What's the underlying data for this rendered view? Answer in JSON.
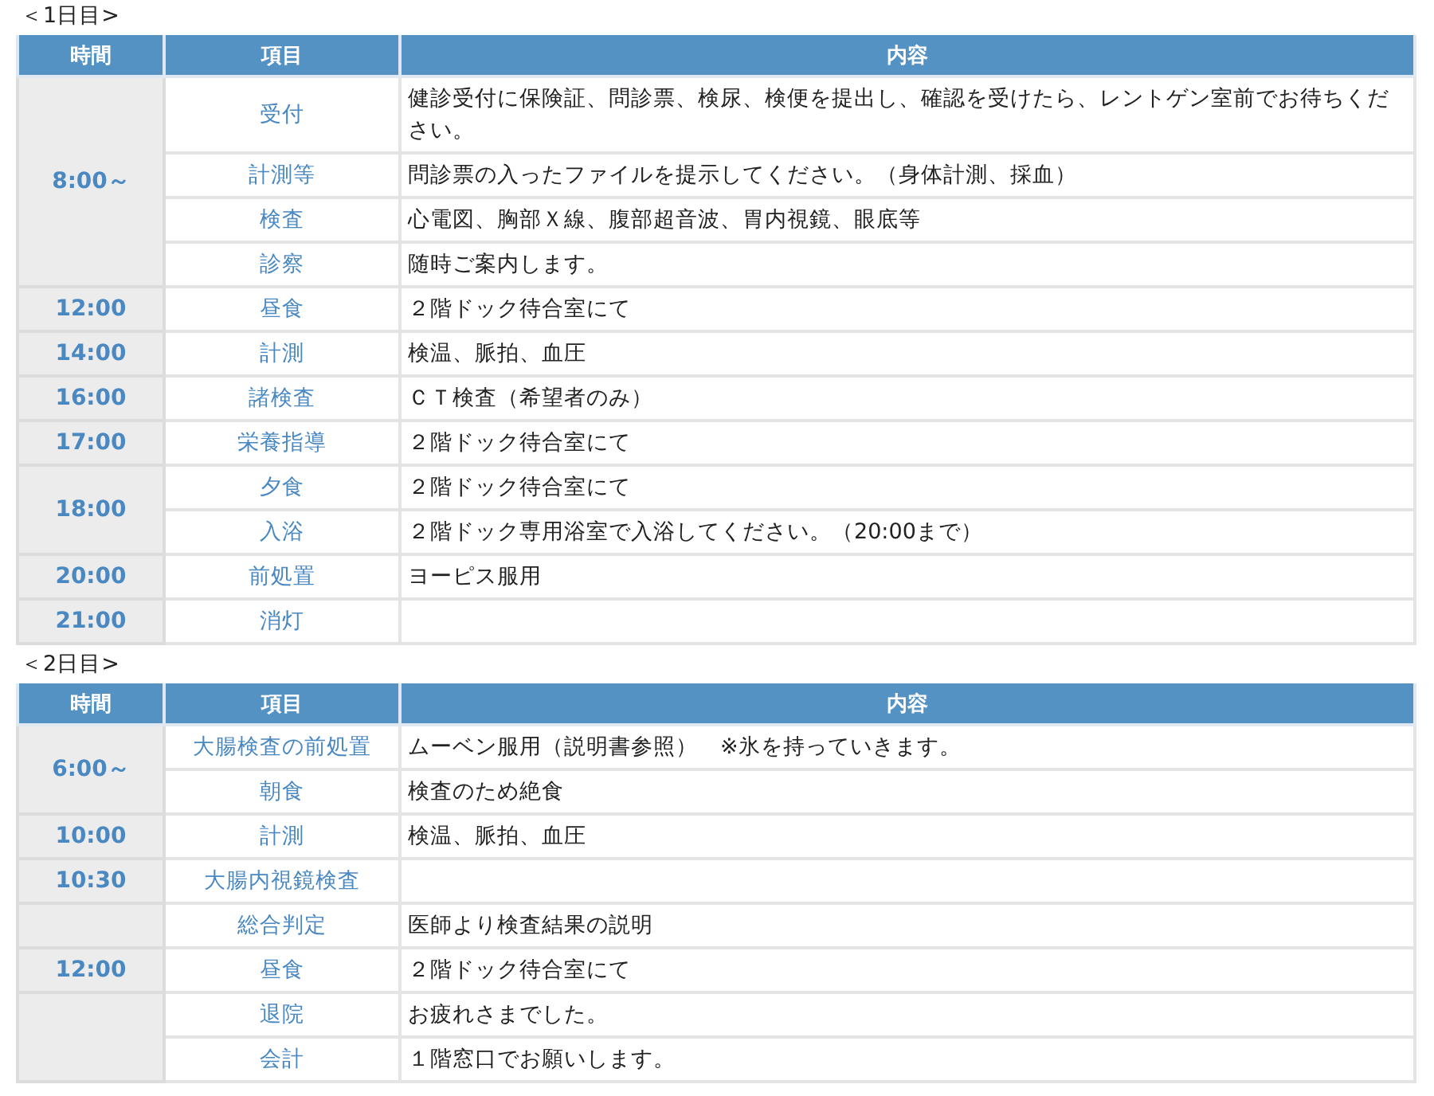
{
  "days": [
    {
      "title": "＜1日目>",
      "columns": [
        "時間",
        "項目",
        "内容"
      ],
      "groups": [
        {
          "time": "8:00～",
          "items": [
            {
              "item": "受付",
              "content": "健診受付に保険証、問診票、検尿、検便を提出し、確認を受けたら、レントゲン室前でお待ちください。"
            },
            {
              "item": "計測等",
              "content": "問診票の入ったファイルを提示してください。（身体計測、採血）"
            },
            {
              "item": "検査",
              "content": "心電図、胸部Ｘ線、腹部超音波、胃内視鏡、眼底等"
            },
            {
              "item": "診察",
              "content": "随時ご案内します。"
            }
          ]
        },
        {
          "time": "12:00",
          "items": [
            {
              "item": "昼食",
              "content": "２階ドック待合室にて"
            }
          ]
        },
        {
          "time": "14:00",
          "items": [
            {
              "item": "計測",
              "content": "検温、脈拍、血圧"
            }
          ]
        },
        {
          "time": "16:00",
          "items": [
            {
              "item": "諸検査",
              "content": "ＣＴ検査（希望者のみ）"
            }
          ]
        },
        {
          "time": "17:00",
          "items": [
            {
              "item": "栄養指導",
              "content": "２階ドック待合室にて"
            }
          ]
        },
        {
          "time": "18:00",
          "items": [
            {
              "item": "夕食",
              "content": "２階ドック待合室にて"
            },
            {
              "item": "入浴",
              "content": "２階ドック専用浴室で入浴してください。（20:00まで）"
            }
          ]
        },
        {
          "time": "20:00",
          "items": [
            {
              "item": "前処置",
              "content": "ヨーピス服用"
            }
          ]
        },
        {
          "time": "21:00",
          "items": [
            {
              "item": "消灯"
            }
          ]
        }
      ]
    },
    {
      "title": "＜2日目>",
      "columns": [
        "時間",
        "項目",
        "内容"
      ],
      "groups": [
        {
          "time": "6:00～",
          "items": [
            {
              "item": "大腸検査の前処置",
              "content": "ムーベン服用（説明書参照）　※氷を持っていきます。"
            },
            {
              "item": "朝食",
              "content": "検査のため絶食"
            }
          ]
        },
        {
          "time": "10:00",
          "items": [
            {
              "item": "計測",
              "content": "検温、脈拍、血圧"
            }
          ]
        },
        {
          "time": "10:30",
          "items": [
            {
              "item": "大腸内視鏡検査"
            }
          ]
        },
        {
          "items": [
            {
              "item": "総合判定",
              "content": "医師より検査結果の説明"
            }
          ]
        },
        {
          "time": "12:00",
          "items": [
            {
              "item": "昼食",
              "content": "２階ドック待合室にて"
            }
          ]
        },
        {
          "items": [
            {
              "item": "退院",
              "content": "お疲れさまでした。"
            },
            {
              "item": "会計",
              "content": "１階窓口でお願いします。"
            }
          ]
        }
      ]
    }
  ]
}
